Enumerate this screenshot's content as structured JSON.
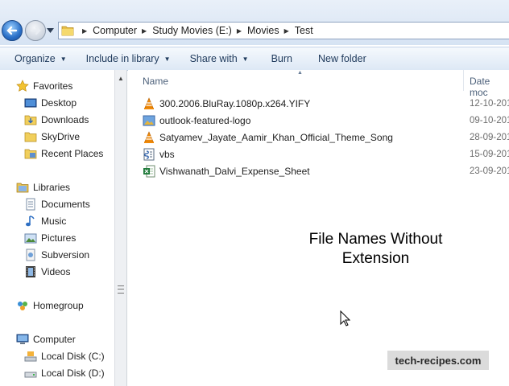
{
  "address": {
    "crumbs": [
      "Computer",
      "Study Movies (E:)",
      "Movies",
      "Test"
    ]
  },
  "toolbar": {
    "organize": "Organize",
    "include_in_library": "Include in library",
    "share_with": "Share with",
    "burn": "Burn",
    "new_folder": "New folder"
  },
  "nav": {
    "favorites": "Favorites",
    "desktop": "Desktop",
    "downloads": "Downloads",
    "skydrive": "SkyDrive",
    "recent_places": "Recent Places",
    "libraries": "Libraries",
    "documents": "Documents",
    "music": "Music",
    "pictures": "Pictures",
    "subversion": "Subversion",
    "videos": "Videos",
    "homegroup": "Homegroup",
    "computer": "Computer",
    "local_c": "Local Disk (C:)",
    "local_d": "Local Disk (D:)"
  },
  "columns": {
    "name": "Name",
    "date": "Date moc"
  },
  "files": [
    {
      "name": "300.2006.BluRay.1080p.x264.YIFY",
      "date": "12-10-201",
      "icon": "vlc-icon"
    },
    {
      "name": "outlook-featured-logo",
      "date": "09-10-201",
      "icon": "image-icon"
    },
    {
      "name": "Satyamev_Jayate_Aamir_Khan_Official_Theme_Song",
      "date": "28-09-201",
      "icon": "vlc-icon"
    },
    {
      "name": "vbs",
      "date": "15-09-201",
      "icon": "script-icon"
    },
    {
      "name": "Vishwanath_Dalvi_Expense_Sheet",
      "date": "23-09-201",
      "icon": "excel-icon"
    }
  ],
  "overlay": {
    "line1": "File Names Without",
    "line2": "Extension"
  },
  "watermark": "tech-recipes.com"
}
